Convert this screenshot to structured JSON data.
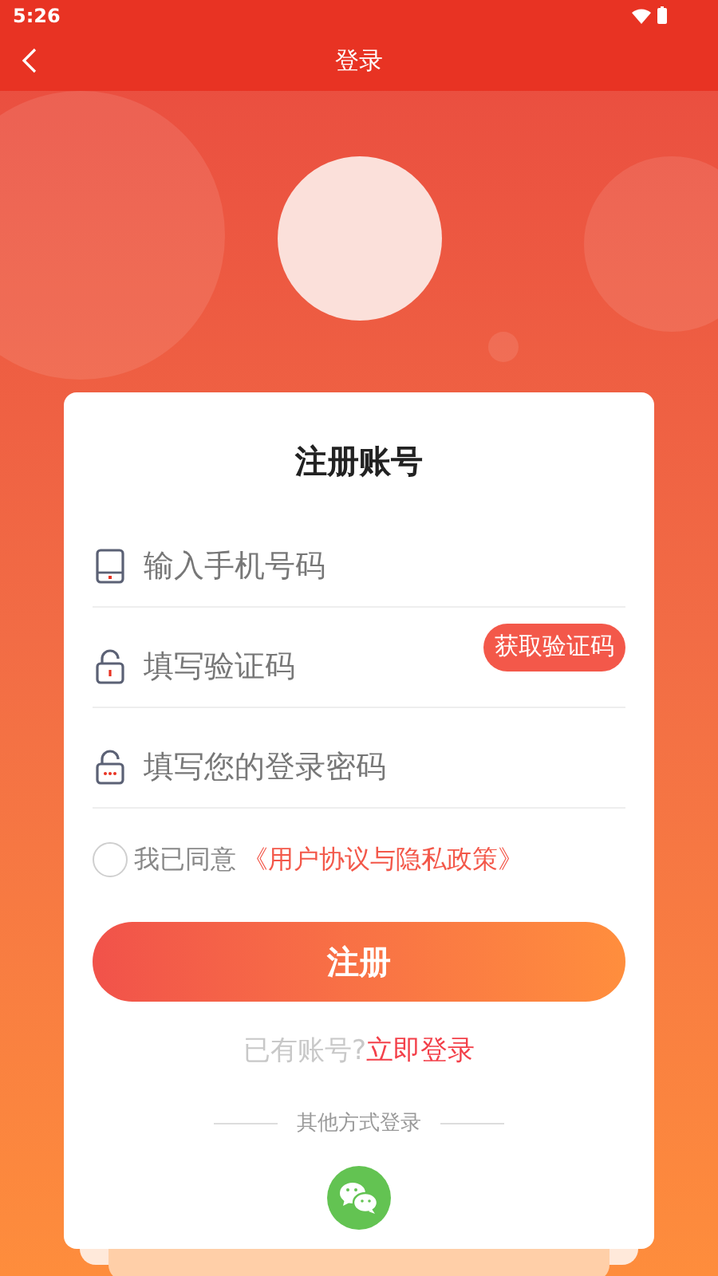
{
  "status_bar": {
    "time": "5:26"
  },
  "header": {
    "title": "登录"
  },
  "form": {
    "title": "注册账号",
    "fields": [
      {
        "kind": "phone",
        "placeholder": "输入手机号码"
      },
      {
        "kind": "code",
        "placeholder": "填写验证码",
        "action": "获取验证码"
      },
      {
        "kind": "password",
        "placeholder": "填写您的登录密码"
      }
    ],
    "agreement": {
      "checked": false,
      "text": "我已同意",
      "link": "《用户协议与隐私政策》"
    },
    "submit": "注册",
    "login_prompt": {
      "text": "已有账号?",
      "link": "立即登录"
    },
    "other_login": "其他方式登录"
  }
}
